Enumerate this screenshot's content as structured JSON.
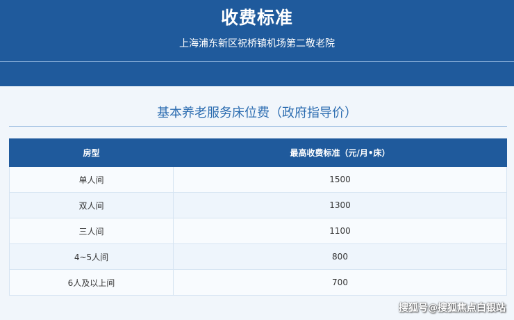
{
  "header": {
    "title": "收费标准",
    "subtitle": "上海浦东新区祝桥镇机场第二敬老院"
  },
  "section": {
    "title": "基本养老服务床位费（政府指导价）"
  },
  "table": {
    "columns": [
      "房型",
      "最高收费标准（元/月•床）"
    ],
    "rows": [
      [
        "单人间",
        "1500"
      ],
      [
        "双人间",
        "1300"
      ],
      [
        "三人间",
        "1100"
      ],
      [
        "4~5人间",
        "800"
      ],
      [
        "6人及以上间",
        "700"
      ]
    ]
  },
  "watermark": "搜狐号@搜狐焦点白银站",
  "colors": {
    "header_bg": "#1f5a9c",
    "section_title": "#2b6cb0",
    "page_bg": "#f1f6fb"
  }
}
